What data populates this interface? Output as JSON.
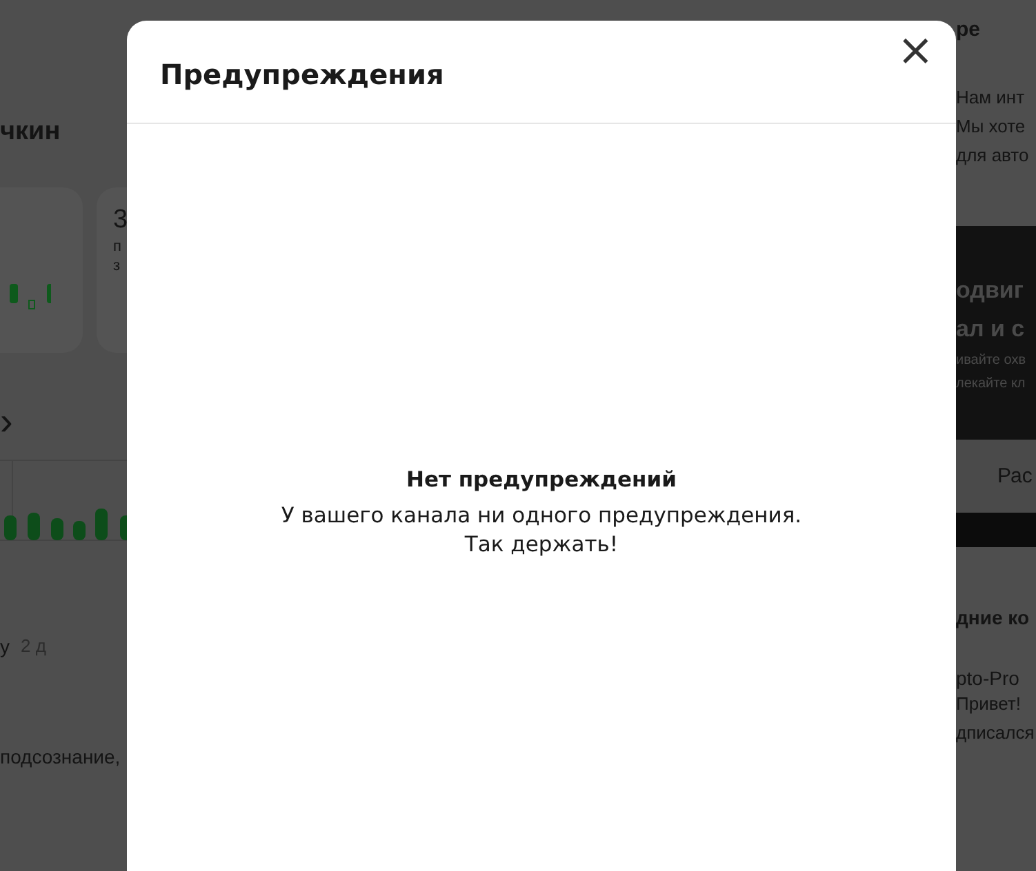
{
  "background": {
    "left": {
      "channel_name": "чкин",
      "card_heading": "3",
      "card_line_1": "п",
      "card_line_2": "з",
      "section_arrow": "›",
      "comment_meta": "у",
      "comment_time": "2 д",
      "comment_text": "подсознание,"
    },
    "right": {
      "section_title": "ре",
      "lines": [
        "Нам инт",
        "Мы хоте",
        "для авто"
      ],
      "promo": {
        "title_lines": [
          "одвиг",
          "ал и с"
        ],
        "text_lines": [
          "ивайте охв",
          "лекайте кл"
        ],
        "button": "Рас"
      },
      "comments_title": "дние ко",
      "comment_author": "pto-Pro",
      "comment_lines": [
        "Привет!",
        "дписался"
      ]
    }
  },
  "dialog": {
    "title": "Предупреждения",
    "close": "×",
    "empty_title": "Нет предупреждений",
    "empty_lines": [
      "У вашего канала ни одного предупреждения.",
      "Так держать!"
    ]
  }
}
